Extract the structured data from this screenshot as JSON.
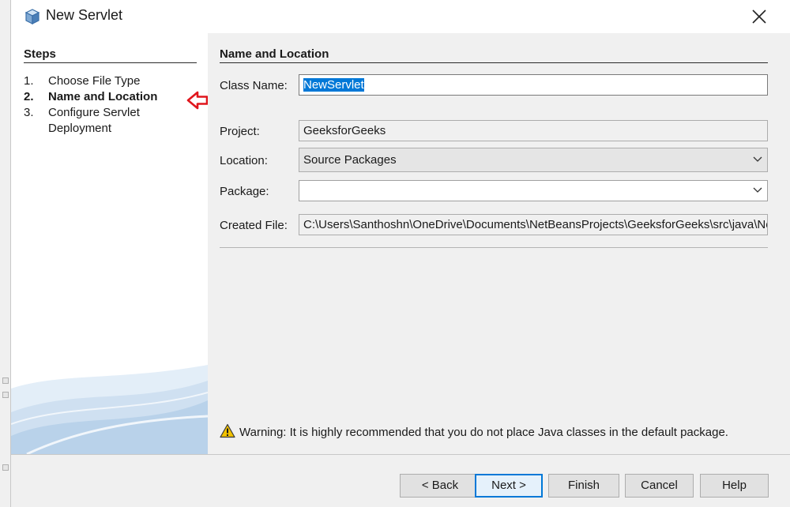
{
  "window": {
    "title": "New Servlet",
    "icon": "cube-icon"
  },
  "steps": {
    "title": "Steps",
    "items": [
      {
        "num": "1.",
        "label": "Choose File Type"
      },
      {
        "num": "2.",
        "label": "Name and Location"
      },
      {
        "num": "3.",
        "label": "Configure Servlet",
        "label_cont": "Deployment"
      }
    ]
  },
  "form": {
    "section_title": "Name and Location",
    "class_name": {
      "label": "Class Name:",
      "value": "NewServlet"
    },
    "project": {
      "label": "Project:",
      "value": "GeeksforGeeks"
    },
    "location": {
      "label": "Location:",
      "value": "Source Packages"
    },
    "package": {
      "label": "Package:",
      "value": ""
    },
    "created_file": {
      "label": "Created File:",
      "value": "C:\\Users\\Santhoshn\\OneDrive\\Documents\\NetBeansProjects\\GeeksforGeeks\\src\\java\\NewServlet.java"
    }
  },
  "warning": {
    "text": "Warning: It is highly recommended that you do not place Java classes in the default package."
  },
  "buttons": {
    "back": "< Back",
    "next": "Next >",
    "finish": "Finish",
    "cancel": "Cancel",
    "help": "Help"
  },
  "colors": {
    "accent": "#0078d7",
    "annotation_arrow": "#e0161d",
    "warning": "#f2c200"
  }
}
